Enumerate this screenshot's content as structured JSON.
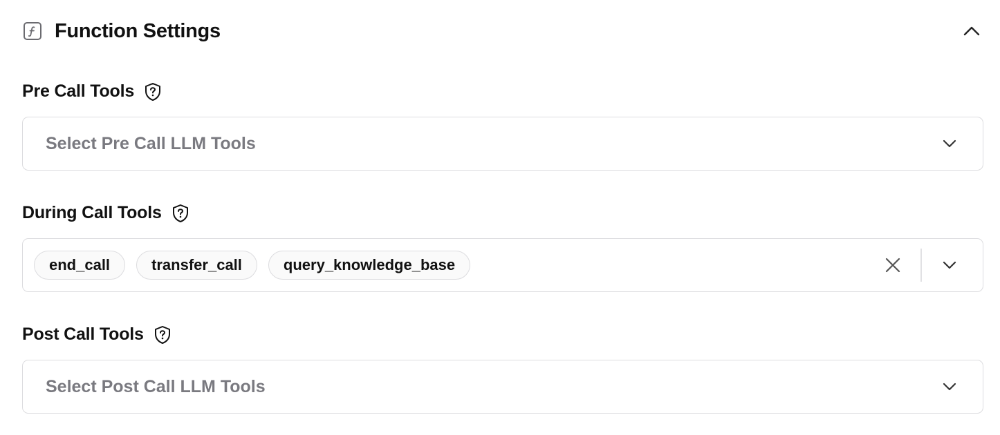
{
  "section": {
    "title": "Function Settings",
    "icon": "function-icon",
    "toggle_icon": "chevron-up-icon"
  },
  "pre_call": {
    "label": "Pre Call Tools",
    "help_icon": "help-shield-icon",
    "placeholder": "Select Pre Call LLM Tools"
  },
  "during_call": {
    "label": "During Call Tools",
    "help_icon": "help-shield-icon",
    "selected": [
      "end_call",
      "transfer_call",
      "query_knowledge_base"
    ]
  },
  "post_call": {
    "label": "Post Call Tools",
    "help_icon": "help-shield-icon",
    "placeholder": "Select Post Call LLM Tools"
  }
}
